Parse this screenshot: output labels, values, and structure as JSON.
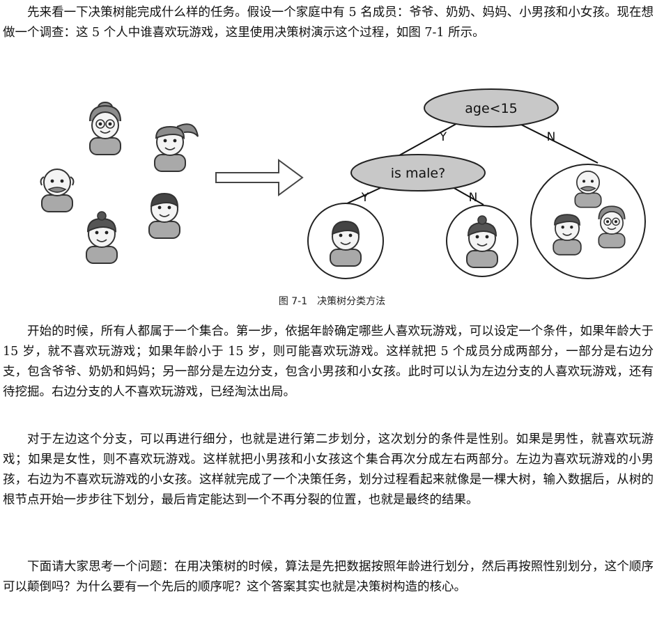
{
  "paragraphs": {
    "p1": "先来看一下决策树能完成什么样的任务。假设一个家庭中有 5 名成员：爷爷、奶奶、妈妈、小男孩和小女孩。现在想做一个调查：这 5 个人中谁喜欢玩游戏，这里使用决策树演示这个过程，如图 7-1 所示。",
    "p2": "开始的时候，所有人都属于一个集合。第一步，依据年龄确定哪些人喜欢玩游戏，可以设定一个条件，如果年龄大于 15 岁，就不喜欢玩游戏；如果年龄小于 15 岁，则可能喜欢玩游戏。这样就把 5 个成员分成两部分，一部分是右边分支，包含爷爷、奶奶和妈妈；另一部分是左边分支，包含小男孩和小女孩。此时可以认为左边分支的人喜欢玩游戏，还有待挖掘。右边分支的人不喜欢玩游戏，已经淘汰出局。",
    "p3": "对于左边这个分支，可以再进行细分，也就是进行第二步划分，这次划分的条件是性别。如果是男性，就喜欢玩游戏；如果是女性，则不喜欢玩游戏。这样就把小男孩和小女孩这个集合再次分成左右两部分。左边为喜欢玩游戏的小男孩，右边为不喜欢玩游戏的小女孩。这样就完成了一个决策任务，划分过程看起来就像是一棵大树，输入数据后，从树的根节点开始一步步往下划分，最后肯定能达到一个不再分裂的位置，也就是最终的结果。",
    "p4": "下面请大家思考一个问题：在用决策树的时候，算法是先把数据按照年龄进行划分，然后再按照性别划分，这个顺序可以颠倒吗？为什么要有一个先后的顺序呢？这个答案其实也就是决策树构造的核心。"
  },
  "figure": {
    "caption": "图 7-1　决策树分类方法",
    "root_condition": "age<15",
    "root_yes": "Y",
    "root_no": "N",
    "sub_condition": "is male?",
    "sub_yes": "Y",
    "sub_no": "N",
    "node_fill": "#c8c8c8",
    "face_fill": "#8c8c8c"
  }
}
